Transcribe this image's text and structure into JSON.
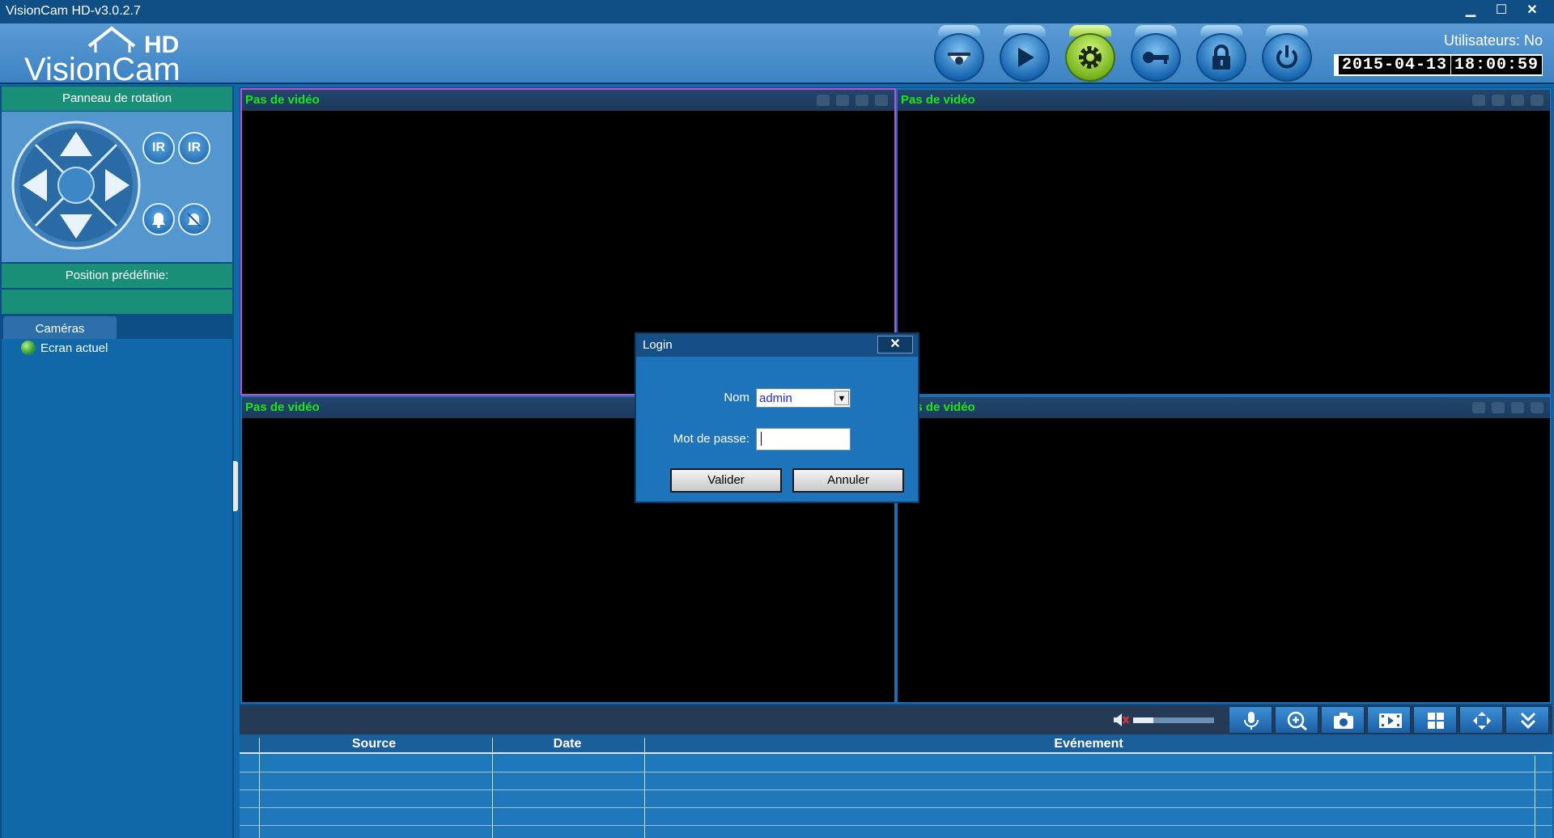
{
  "window": {
    "title": "VisionCam HD-v3.0.2.7"
  },
  "header": {
    "logo_text": "VisionCam",
    "logo_hd": "HD",
    "users_label": "Utilisateurs: No",
    "date": "2015-04-13",
    "time": "18:00:59",
    "toolbar_icons": [
      "camera-dome-icon",
      "play-icon",
      "settings-gear-icon",
      "key-icon",
      "lock-icon",
      "power-icon"
    ],
    "active_toolbar_icon": "settings-gear-icon",
    "active_color": "#8cc230"
  },
  "sidebar": {
    "rotation_panel_title": "Panneau de rotation",
    "ir_labels": [
      "IR",
      "IR"
    ],
    "preset_label": "Position prédéfinie:",
    "cameras_tab": "Caméras",
    "camera_items": [
      "Ecran actuel"
    ]
  },
  "videos": {
    "no_video_label": "Pas de vidéo",
    "tile_count": 4,
    "selected_tile_color": "#c04fd8",
    "label_color": "#19e619"
  },
  "bottom_toolbar": {
    "volume_level": 0.25,
    "buttons": [
      "microphone-icon",
      "zoom-in-icon",
      "snapshot-camera-icon",
      "record-film-icon",
      "grid-layout-icon",
      "fullscreen-arrows-icon",
      "collapse-down-icon"
    ]
  },
  "event_log": {
    "columns": [
      "Source",
      "Date",
      "Evénement"
    ],
    "rows": []
  },
  "login_dialog": {
    "title": "Login",
    "close": "✕",
    "name_label": "Nom",
    "name_value": "admin",
    "password_label": "Mot de passe:",
    "password_value": "",
    "ok_label": "Valider",
    "cancel_label": "Annuler"
  }
}
